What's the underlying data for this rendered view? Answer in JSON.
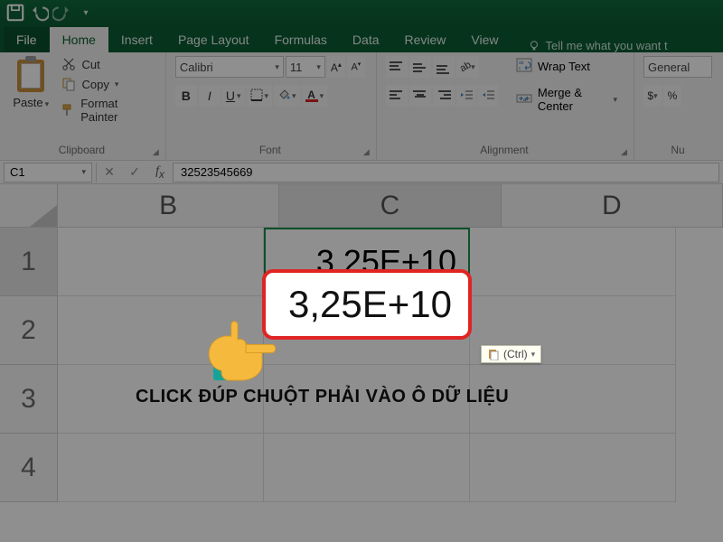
{
  "ribbon": {
    "tabs": [
      "File",
      "Home",
      "Insert",
      "Page Layout",
      "Formulas",
      "Data",
      "Review",
      "View"
    ],
    "tell_me": "Tell me what you want t",
    "clipboard": {
      "label": "Clipboard",
      "paste": "Paste",
      "cut": "Cut",
      "copy": "Copy",
      "format_painter": "Format Painter"
    },
    "font": {
      "label": "Font",
      "name": "Calibri",
      "size": "11"
    },
    "alignment": {
      "label": "Alignment",
      "wrap": "Wrap Text",
      "merge": "Merge & Center"
    },
    "number": {
      "label": "Nu",
      "format": "General"
    }
  },
  "formula_bar": {
    "name_box": "C1",
    "value": "32523545669"
  },
  "sheet": {
    "columns": [
      "B",
      "C",
      "D"
    ],
    "rows": [
      "1",
      "2",
      "3",
      "4"
    ],
    "selected_cell": "C1",
    "cells": {
      "C1": "3,25E+10"
    }
  },
  "annotation": {
    "caption": "CLICK ĐÚP CHUỘT PHẢI VÀO Ô DỮ LIỆU",
    "ctrl_chip": "(Ctrl)",
    "highlight_color": "#e02424",
    "hand_color": "#f5b93e",
    "hand_cuff_color": "#17a398"
  },
  "colors": {
    "excel_green": "#0c5c33",
    "selection_green": "#1a8f4b",
    "font_color_red": "#d02424",
    "fill_yellow": "#ffe36b"
  }
}
